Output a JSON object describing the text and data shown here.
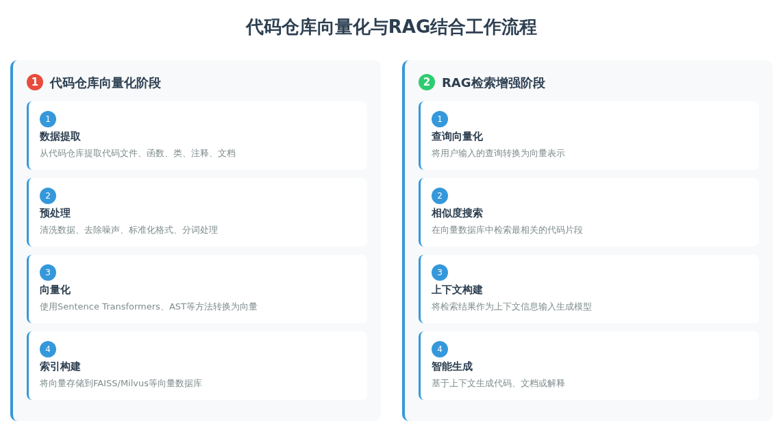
{
  "title": "代码仓库向量化与RAG结合工作流程",
  "phases": [
    {
      "number": "1",
      "color": "#e74c3c",
      "title": "代码仓库向量化阶段",
      "steps": [
        {
          "number": "1",
          "title": "数据提取",
          "description": "从代码仓库提取代码文件、函数、类、注释、文档"
        },
        {
          "number": "2",
          "title": "预处理",
          "description": "清洗数据、去除噪声、标准化格式、分词处理"
        },
        {
          "number": "3",
          "title": "向量化",
          "description": "使用Sentence Transformers、AST等方法转换为向量"
        },
        {
          "number": "4",
          "title": "索引构建",
          "description": "将向量存储到FAISS/Milvus等向量数据库"
        }
      ]
    },
    {
      "number": "2",
      "color": "#2ecc71",
      "title": "RAG检索增强阶段",
      "steps": [
        {
          "number": "1",
          "title": "查询向量化",
          "description": "将用户输入的查询转换为向量表示"
        },
        {
          "number": "2",
          "title": "相似度搜索",
          "description": "在向量数据库中检索最相关的代码片段"
        },
        {
          "number": "3",
          "title": "上下文构建",
          "description": "将检索结果作为上下文信息输入生成模型"
        },
        {
          "number": "4",
          "title": "智能生成",
          "description": "基于上下文生成代码、文档或解释"
        }
      ]
    }
  ]
}
